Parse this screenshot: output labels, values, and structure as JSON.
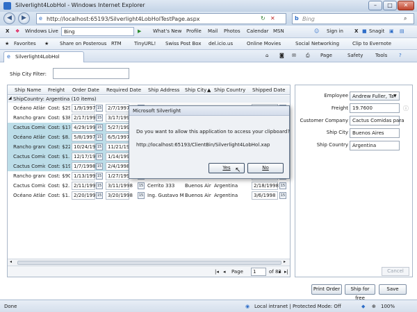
{
  "window": {
    "title": "Silverlight4LobHol - Windows Internet Explorer",
    "buttons": [
      "–",
      "□",
      "✕"
    ]
  },
  "address": {
    "url": "http://localhost:65193/Silverlight4LobHolTestPage.aspx",
    "search_placeholder": "Bing"
  },
  "toolbar": {
    "close_glyph": "X",
    "windows_live": "Windows Live",
    "search_value": "Bing",
    "items": [
      "What's New",
      "Profile",
      "Mail",
      "Photos",
      "Calendar",
      "MSN"
    ],
    "sign_in": "Sign in",
    "snagit": "Snagit"
  },
  "favorites": {
    "label": "Favorites",
    "items": [
      "Share on Posterous",
      "RTM",
      "TinyURL!",
      "Swiss Post Box",
      "del.icio.us",
      "Online Movies",
      "Social Networking",
      "Clip to Evernote"
    ]
  },
  "tab": {
    "label": "Silverlight4LobHol",
    "commands": [
      "Page",
      "Safety",
      "Tools"
    ]
  },
  "filter": {
    "label": "Ship City Filter:",
    "value": ""
  },
  "grid": {
    "columns": [
      "Ship Name",
      "Freight",
      "Order Date",
      "Required Date",
      "Ship Address",
      "Ship City",
      "Ship Country",
      "Shipped Date"
    ],
    "group_label": "ShipCountry: Argentina (10 items)",
    "rows": [
      {
        "name": "Océano Atlán",
        "freight": "Cost: $29",
        "order": "1/9/1997",
        "required": "2/7/1997",
        "address": "",
        "city": "",
        "country": "",
        "shipped": "",
        "selected": false
      },
      {
        "name": "Rancho granc",
        "freight": "Cost: $38",
        "order": "2/17/1998",
        "required": "3/17/1998",
        "address": "",
        "city": "",
        "country": "",
        "shipped": "",
        "selected": false
      },
      {
        "name": "Cactus Comic",
        "freight": "Cost: $17",
        "order": "4/29/1998",
        "required": "5/27/1998",
        "address": "",
        "city": "",
        "country": "",
        "shipped": "",
        "selected": true
      },
      {
        "name": "Océano Atlán",
        "freight": "Cost: $8.",
        "order": "5/8/1997",
        "required": "6/5/1997",
        "address": "",
        "city": "",
        "country": "",
        "shipped": "",
        "selected": true
      },
      {
        "name": "Rancho granc",
        "freight": "Cost: $22",
        "order": "10/24/1997",
        "required": "11/21/1997",
        "address": "",
        "city": "",
        "country": "",
        "shipped": "",
        "selected": true
      },
      {
        "name": "Cactus Comic",
        "freight": "Cost: $1.",
        "order": "12/17/1997",
        "required": "1/14/1998",
        "address": "",
        "city": "",
        "country": "",
        "shipped": "",
        "selected": true
      },
      {
        "name": "Cactus Comic",
        "freight": "Cost: $19",
        "order": "1/7/1998",
        "required": "2/4/1998",
        "address": "",
        "city": "",
        "country": "",
        "shipped": "",
        "selected": true
      },
      {
        "name": "Rancho granc",
        "freight": "Cost: $90",
        "order": "1/13/1998",
        "required": "1/27/1998",
        "address": "",
        "city": "",
        "country": "",
        "shipped": "",
        "selected": false
      },
      {
        "name": "Cactus Comic",
        "freight": "Cost: $2.",
        "order": "2/11/1998",
        "required": "3/11/1998",
        "address": "Cerrito 333",
        "city": "Buenos Air",
        "country": "Argentina",
        "shipped": "2/18/1998",
        "selected": false
      },
      {
        "name": "Océano Atlán",
        "freight": "Cost: $1.",
        "order": "2/20/1998",
        "required": "3/20/1998",
        "address": "Ing. Gustavo M",
        "city": "Buenos Air",
        "country": "Argentina",
        "shipped": "3/6/1998",
        "selected": false
      }
    ],
    "pager": {
      "label": "Page",
      "current": "1",
      "of": "of 83"
    }
  },
  "details": {
    "employee_label": "Employee",
    "employee_value": "Andrew Fuller, Ta",
    "freight_label": "Freight",
    "freight_value": "19.7600",
    "customer_label": "Customer Company",
    "customer_value": "Cactus Comidas para",
    "city_label": "Ship City",
    "city_value": "Buenos Aires",
    "country_label": "Ship Country",
    "country_value": "Argentina",
    "cancel": "Cancel"
  },
  "buttons": {
    "print": "Print Order",
    "ship": "Ship for free",
    "save": "Save"
  },
  "dialog": {
    "title": "Microsoft Silverlight",
    "message": "Do you want to allow this application to access your clipboard?",
    "url": "http://localhost:65193/ClientBin/Silverlight4LobHol.xap",
    "yes": "Yes",
    "no": "No"
  },
  "status": {
    "left": "Done",
    "zone": "Local intranet | Protected Mode: Off",
    "zoom": "100%"
  }
}
